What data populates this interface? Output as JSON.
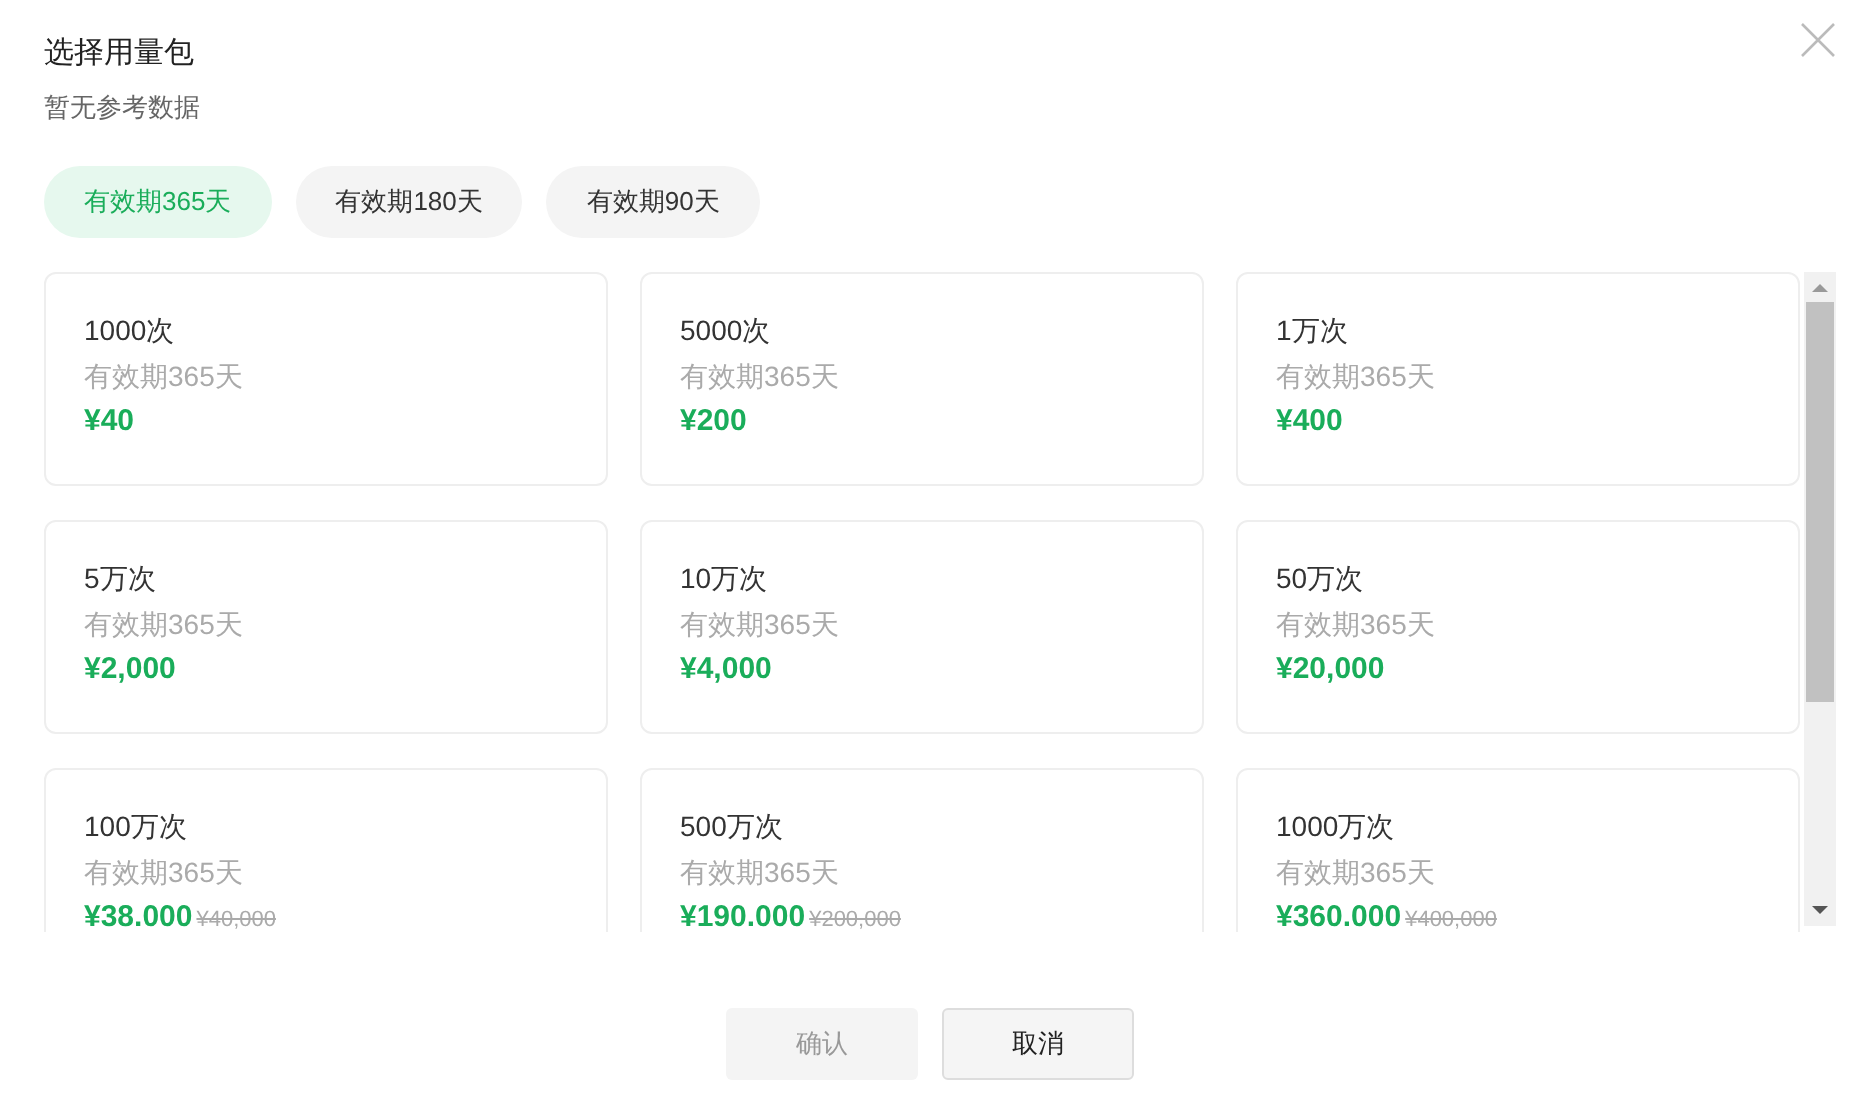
{
  "dialog": {
    "title": "选择用量包",
    "subtitle": "暂无参考数据"
  },
  "tabs": [
    {
      "label": "有效期365天",
      "selected": true
    },
    {
      "label": "有效期180天",
      "selected": false
    },
    {
      "label": "有效期90天",
      "selected": false
    }
  ],
  "packages": [
    {
      "quantity": "1000次",
      "validity": "有效期365天",
      "price": "¥40"
    },
    {
      "quantity": "5000次",
      "validity": "有效期365天",
      "price": "¥200"
    },
    {
      "quantity": "1万次",
      "validity": "有效期365天",
      "price": "¥400"
    },
    {
      "quantity": "5万次",
      "validity": "有效期365天",
      "price": "¥2,000"
    },
    {
      "quantity": "10万次",
      "validity": "有效期365天",
      "price": "¥4,000"
    },
    {
      "quantity": "50万次",
      "validity": "有效期365天",
      "price": "¥20,000"
    },
    {
      "quantity": "100万次",
      "validity": "有效期365天",
      "price": "¥38.000",
      "original_price": "¥40,000"
    },
    {
      "quantity": "500万次",
      "validity": "有效期365天",
      "price": "¥190.000",
      "original_price": "¥200,000"
    },
    {
      "quantity": "1000万次",
      "validity": "有效期365天",
      "price": "¥360.000",
      "original_price": "¥400,000"
    }
  ],
  "buttons": [
    {
      "label": "确认",
      "kind": "primary",
      "disabled": true
    },
    {
      "label": "取消",
      "kind": "secondary",
      "disabled": false
    }
  ]
}
